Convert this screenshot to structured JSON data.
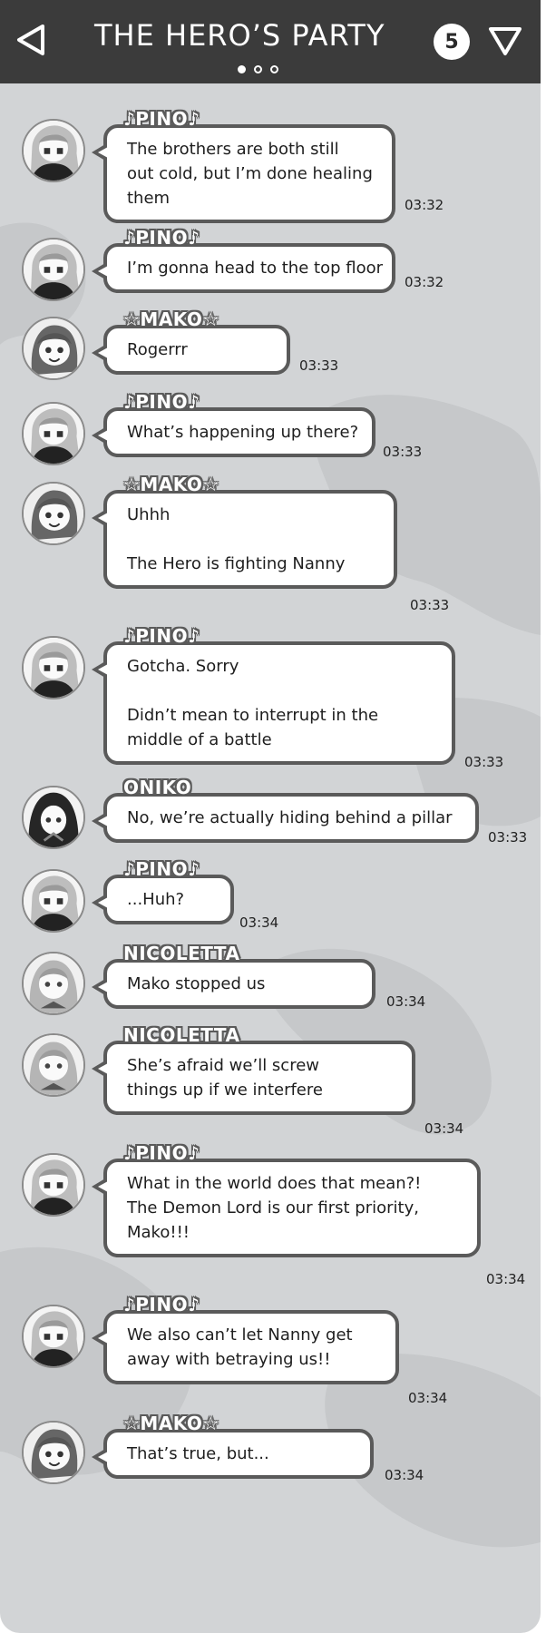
{
  "header": {
    "title": "THE HERO’S PARTY",
    "unread_count": "5",
    "back_icon": "back-triangle-icon",
    "menu_icon": "menu-triangle-down-icon",
    "page_dots": [
      true,
      false,
      false
    ]
  },
  "messages": [
    {
      "sender": "♪PINO♪",
      "lines": [
        "The brothers are both still",
        "out cold, but I’m done healing",
        "them"
      ],
      "time": "03:32"
    },
    {
      "sender": "♪PINO♪",
      "lines": [
        "I’m gonna head to the top floor"
      ],
      "time": "03:32"
    },
    {
      "sender": "☆MAKO☆",
      "lines": [
        "Rogerrr"
      ],
      "time": "03:33"
    },
    {
      "sender": "♪PINO♪",
      "lines": [
        "What’s happening up there?"
      ],
      "time": "03:33"
    },
    {
      "sender": "☆MAKO☆",
      "lines": [
        "Uhhh",
        "",
        "The Hero is fighting Nanny"
      ],
      "time": "03:33"
    },
    {
      "sender": "♪PINO♪",
      "lines": [
        "Gotcha. Sorry",
        "",
        "Didn’t mean to interrupt in the",
        "middle of a battle"
      ],
      "time": "03:33"
    },
    {
      "sender": "ONIKO",
      "lines": [
        "No, we’re actually hiding behind a pillar"
      ],
      "time": "03:33"
    },
    {
      "sender": "♪PINO♪",
      "lines": [
        "...Huh?"
      ],
      "time": "03:34"
    },
    {
      "sender": "NICOLETTA",
      "lines": [
        "Mako stopped us"
      ],
      "time": "03:34"
    },
    {
      "sender": "NICOLETTA",
      "lines": [
        "She’s afraid we’ll screw",
        "things up if we interfere"
      ],
      "time": "03:34"
    },
    {
      "sender": "♪PINO♪",
      "lines": [
        "What in the world does that mean?!",
        "The Demon Lord is our first priority,",
        "Mako!!!"
      ],
      "time": "03:34"
    },
    {
      "sender": "♪PINO♪",
      "lines": [
        "We also can’t let Nanny get",
        "away with betraying us!!"
      ],
      "time": "03:34"
    },
    {
      "sender": "☆MAKO☆",
      "lines": [
        "That’s true, but..."
      ],
      "time": "03:34"
    }
  ]
}
